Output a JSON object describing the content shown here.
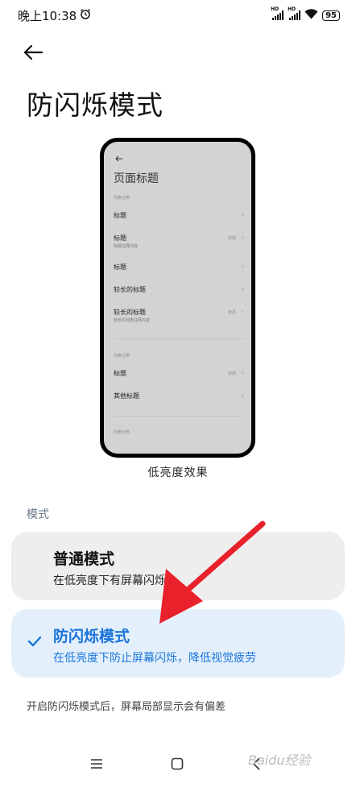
{
  "status_bar": {
    "time": "晚上10:38",
    "alarm_icon": "alarm-icon",
    "signal_label_1": "HD",
    "signal_label_2": "HD",
    "wifi_icon": "wifi-icon",
    "battery": "95"
  },
  "header": {
    "back_icon": "back-arrow-icon",
    "title": "防闪烁模式"
  },
  "preview": {
    "title": "页面标题",
    "categories": [
      "列表分类",
      "列表分类",
      "列表分类"
    ],
    "rows": [
      {
        "title": "标题",
        "subtitle": "",
        "status": ""
      },
      {
        "title": "标题",
        "subtitle": "标题注释内容",
        "status": "状态"
      },
      {
        "title": "标题",
        "subtitle": "",
        "status": ""
      },
      {
        "title": "较长的标题",
        "subtitle": "",
        "status": ""
      },
      {
        "title": "较长的标题",
        "subtitle": "较长的列表注释内容",
        "status": "状态"
      },
      {
        "title": "标题",
        "subtitle": "",
        "status": "状态"
      },
      {
        "title": "其他标题",
        "subtitle": "",
        "status": ""
      }
    ],
    "chevron": "›",
    "caption": "低亮度效果"
  },
  "modes": {
    "section_label": "模式",
    "normal": {
      "title": "普通模式",
      "subtitle": "在低亮度下有屏幕闪烁"
    },
    "anti_flicker": {
      "title": "防闪烁模式",
      "subtitle": "在低亮度下防止屏幕闪烁，降低视觉疲劳",
      "selected": true
    }
  },
  "note": "开启防闪烁模式后，屏幕局部显示会有偏差",
  "nav": {
    "menu_icon": "menu-icon",
    "home_icon": "home-icon",
    "back_icon": "back-icon"
  },
  "watermark": "Baidu经验",
  "colors": {
    "accent": "#1a73d9",
    "selected_card": "#e3f0fc",
    "unselected_card": "#eeeeee",
    "annotation_arrow": "#e8212b"
  }
}
